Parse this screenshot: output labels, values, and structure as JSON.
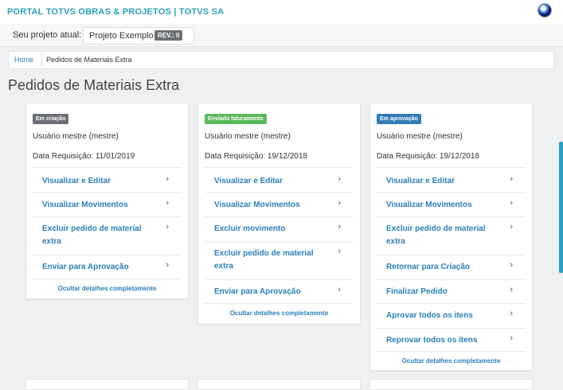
{
  "header": {
    "title": "PORTAL TOTVS OBRAS & PROJETOS | TOTVS SA",
    "logo_icon": "totvs-logo-icon"
  },
  "project": {
    "label": "Seu projeto atual:",
    "name": "Projeto Exemplo",
    "rev": "REV.: 0"
  },
  "breadcrumb": {
    "home": "Home",
    "current": "Pedidos de Materiais Extra"
  },
  "page": {
    "title": "Pedidos de Materiais Extra"
  },
  "colors": {
    "accent": "#2a7fb8",
    "status_em_criacao": "#6c6f73",
    "status_enviado_faturamento": "#5cb85c",
    "status_em_aprovacao": "#337ab7"
  },
  "cards": [
    {
      "status": "Em criação",
      "owner": "Usuário mestre (mestre)",
      "date": "Data Requisição: 11/01/2019",
      "actions": [
        "Visualizar e Editar",
        "Visualizar Movimentos",
        "Excluir pedido de material extra",
        "Enviar para Aprovação"
      ],
      "hide_link": "Ocultar detalhes completamente"
    },
    {
      "status": "Enviado faturamento",
      "owner": "Usuário mestre (mestre)",
      "date": "Data Requisição: 19/12/2018",
      "actions": [
        "Visualizar e Editar",
        "Visualizar Movimentos",
        "Excluir movimento",
        "Excluir pedido de material extra",
        "Enviar para Aprovação"
      ],
      "hide_link": "Ocultar detalhes completamente"
    },
    {
      "status": "Em aprovação",
      "owner": "Usuário mestre (mestre)",
      "date": "Data Requisição: 19/12/2018",
      "actions": [
        "Visualizar e Editar",
        "Visualizar Movimentos",
        "Excluir pedido de material extra",
        "Retornar para Criação",
        "Finalizar Pedido",
        "Aprovar todos os itens",
        "Reprovar todos os itens"
      ],
      "hide_link": "Ocultar detalhes completamente"
    }
  ],
  "chevron": "›"
}
